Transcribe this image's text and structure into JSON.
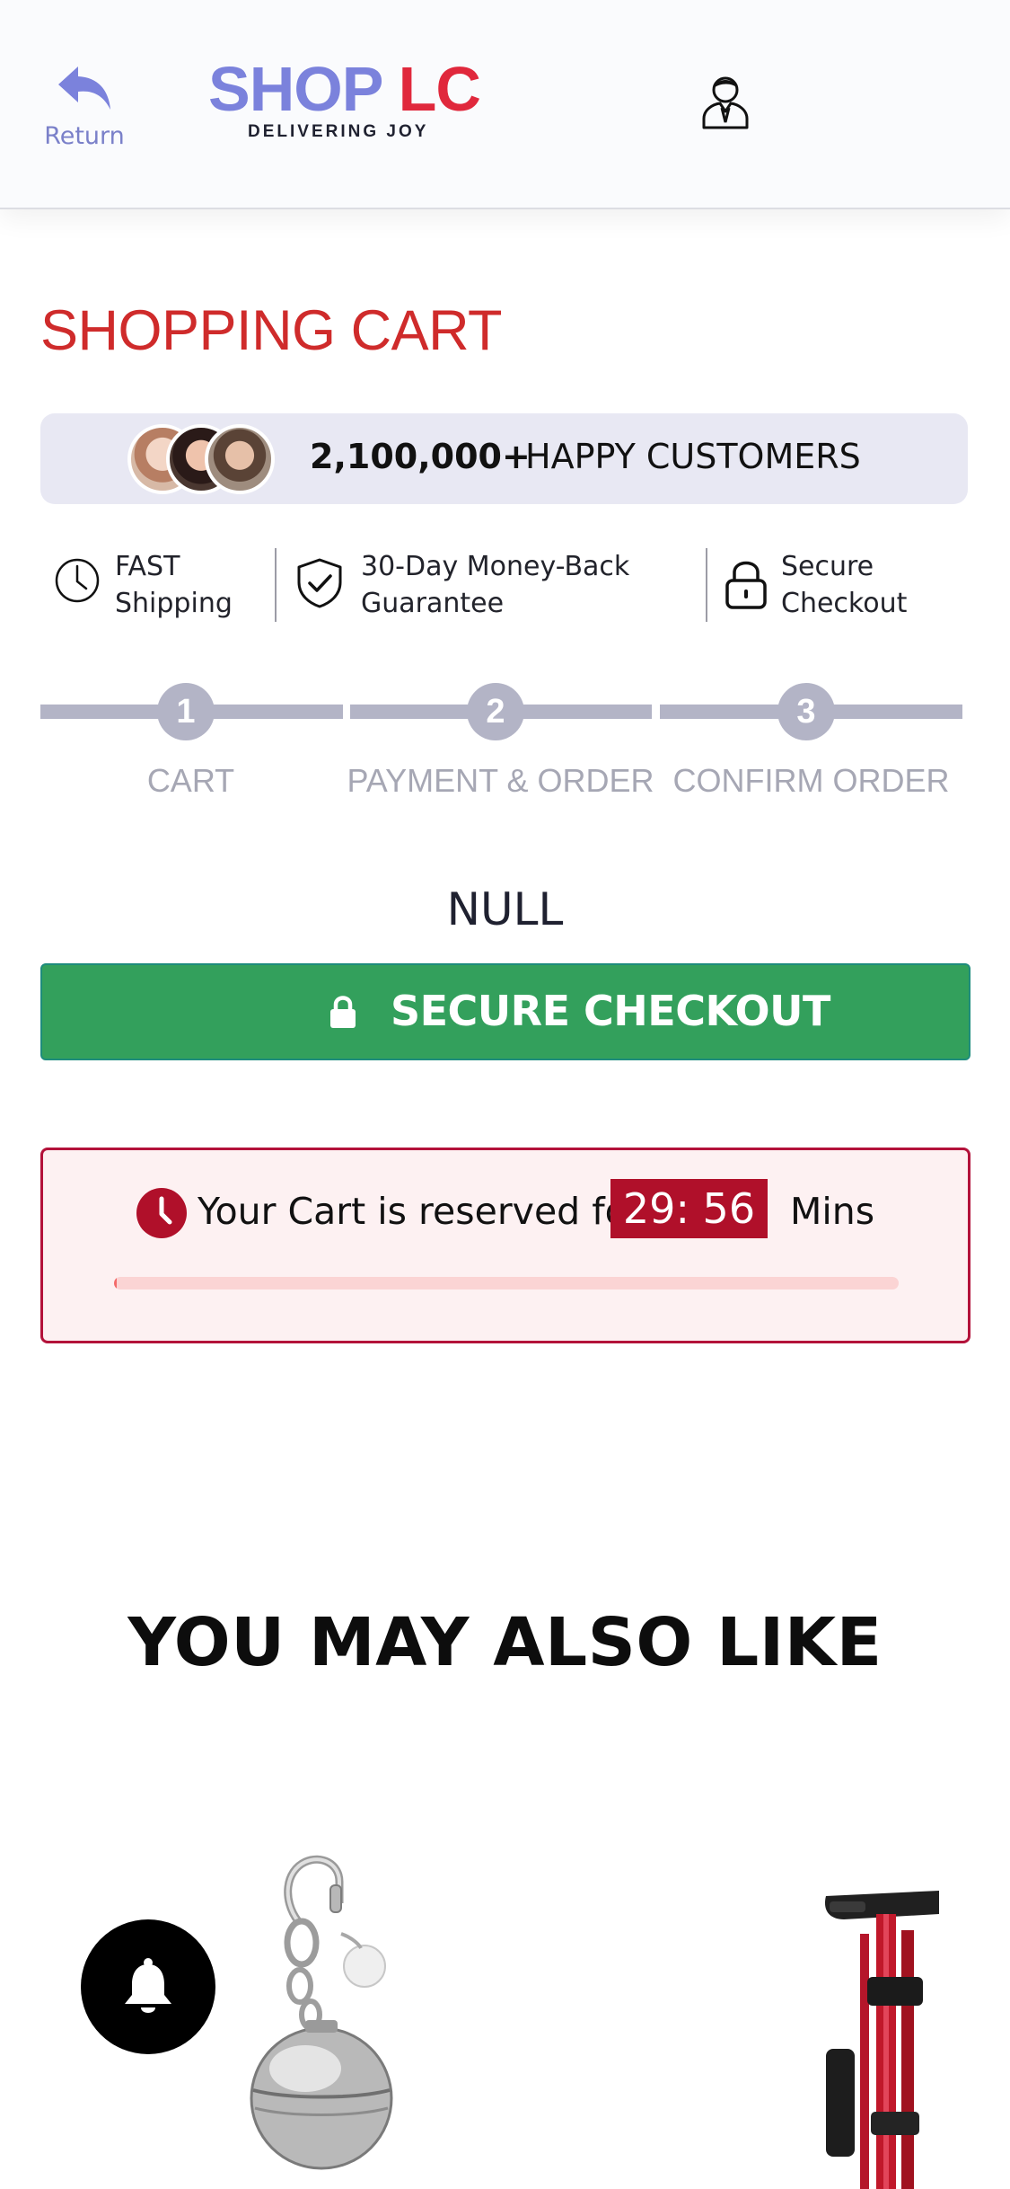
{
  "header": {
    "return_label": "Return",
    "logo": {
      "shop": "SHOP",
      "lc": "LC",
      "tagline": "DELIVERING JOY"
    }
  },
  "page_title": "SHOPPING CART",
  "customers": {
    "count": "2,100,000+",
    "label": "HAPPY CUSTOMERS"
  },
  "features": [
    {
      "icon": "clock-icon",
      "line1": "FAST",
      "line2": "Shipping"
    },
    {
      "icon": "shield-check-icon",
      "line1": "30-Day Money-Back",
      "line2": "Guarantee"
    },
    {
      "icon": "lock-icon",
      "line1": "Secure",
      "line2": "Checkout"
    }
  ],
  "steps": [
    {
      "number": "1",
      "label": "CART"
    },
    {
      "number": "2",
      "label": "PAYMENT & ORDER"
    },
    {
      "number": "3",
      "label": "CONFIRM ORDER"
    }
  ],
  "cart_message": "NULL",
  "checkout": {
    "label": "SECURE CHECKOUT"
  },
  "reservation": {
    "text": "Your Cart is reserved for",
    "timer": "29: 56",
    "unit": "Mins",
    "progress_fraction": 0.003
  },
  "recommendations": {
    "title": "YOU MAY ALSO LIKE"
  },
  "colors": {
    "brand_purple": "#7b82dc",
    "brand_red": "#e0283c",
    "title_red": "#cf2b2b",
    "checkout_green": "#33a05c",
    "timer_red": "#b0102a",
    "step_gray": "#b3b4c6"
  }
}
